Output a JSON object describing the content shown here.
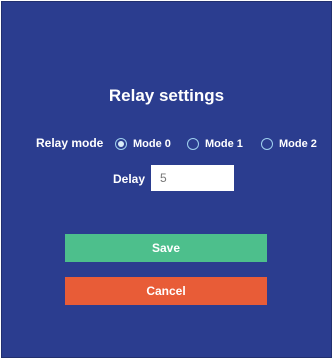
{
  "dialog": {
    "title": "Relay settings",
    "relay_mode": {
      "label": "Relay mode",
      "options": [
        "Mode 0",
        "Mode 1",
        "Mode 2"
      ],
      "selected": "Mode 0"
    },
    "delay": {
      "label": "Delay",
      "value": "5"
    },
    "buttons": {
      "save": "Save",
      "cancel": "Cancel"
    }
  },
  "colors": {
    "background": "#2b3d8f",
    "save": "#4dbf8c",
    "cancel": "#e85c37",
    "radio_ring": "#9fd0ee"
  }
}
